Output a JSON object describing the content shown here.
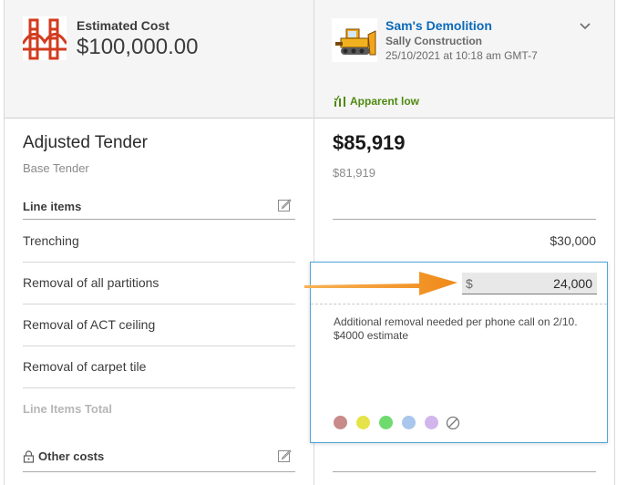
{
  "header": {
    "estimated_cost_label": "Estimated Cost",
    "estimated_cost_value": "$100,000.00",
    "bidder": {
      "name": "Sam's Demolition",
      "company": "Sally Construction",
      "submitted": "25/10/2021 at 10:18 am GMT-7"
    },
    "apparent_low": "Apparent low"
  },
  "left": {
    "adjusted_tender": "Adjusted Tender",
    "base_tender": "Base Tender",
    "line_items_label": "Line items",
    "line_items": [
      "Trenching",
      "Removal of all partitions",
      "Removal of ACT ceiling",
      "Removal of carpet tile"
    ],
    "line_items_total": "Line Items Total",
    "other_costs_label": "Other costs"
  },
  "right": {
    "adjusted_value": "$85,919",
    "base_value": "$81,919",
    "trenching_value": "$30,000"
  },
  "popup": {
    "currency": "$",
    "amount": "24,000",
    "note": "Additional removal needed per phone call on 2/10. $4000 estimate",
    "swatches": [
      "#c98a8a",
      "#e6e34a",
      "#6fdb6f",
      "#a9c7ec",
      "#d2b5ec"
    ]
  },
  "colors": {
    "link": "#0b6ab8",
    "apparent_low": "#4f8a10",
    "popup_border": "#4ea6d9",
    "arrow": "#f39325"
  }
}
